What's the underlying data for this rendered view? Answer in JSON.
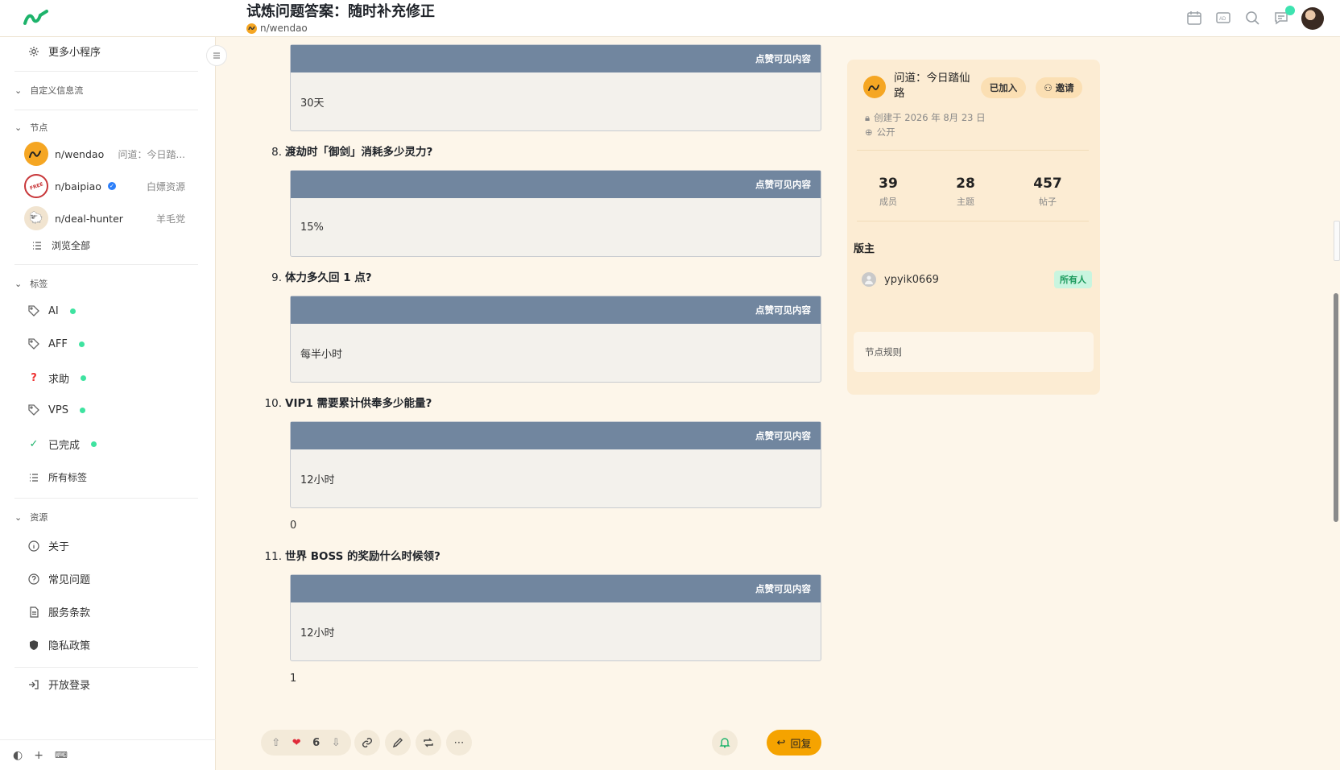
{
  "header": {
    "title": "试炼问题答案：随时补充修正",
    "node": "n/wendao"
  },
  "sidebar": {
    "more_apps": "更多小程序",
    "custom_feed": "自定义信息流",
    "nodes_section": "节点",
    "nodes": [
      {
        "name": "n/wendao",
        "sub": "问道：今日踏...",
        "color": "#f5a623"
      },
      {
        "name": "n/baipiao",
        "sub": "白嫖资源",
        "color": "#c8373a"
      },
      {
        "name": "n/deal-hunter",
        "sub": "羊毛党",
        "color": "#f1e4d0"
      }
    ],
    "browse_all": "浏览全部",
    "tags_section": "标签",
    "tags": [
      {
        "label": "AI",
        "icon": "tag-icon"
      },
      {
        "label": "AFF",
        "icon": "tag-icon"
      },
      {
        "label": "求助",
        "icon": "question-icon"
      },
      {
        "label": "VPS",
        "icon": "tag-icon"
      },
      {
        "label": "已完成",
        "icon": "check-icon"
      }
    ],
    "all_tags": "所有标签",
    "resources_section": "资源",
    "resources": [
      {
        "label": "关于",
        "icon": "info-icon"
      },
      {
        "label": "常见问题",
        "icon": "help-circle-icon"
      },
      {
        "label": "服务条款",
        "icon": "document-icon"
      },
      {
        "label": "隐私政策",
        "icon": "shield-icon"
      }
    ],
    "open_login": "开放登录"
  },
  "content": {
    "hidden_label": "点赞可见内容",
    "items": [
      {
        "num": "",
        "question": "",
        "answer": "30天",
        "after": ""
      },
      {
        "num": "8.",
        "question": "渡劫时「御剑」消耗多少灵力?",
        "answer": "15%",
        "after": ""
      },
      {
        "num": "9.",
        "question": "体力多久回 1 点?",
        "answer": "每半小时",
        "after": ""
      },
      {
        "num": "10.",
        "question": "VIP1 需要累计供奉多少能量?",
        "answer": "12小时",
        "after": "0"
      },
      {
        "num": "11.",
        "question": "世界 BOSS 的奖励什么时候领?",
        "answer": "12小时",
        "after": "1"
      }
    ]
  },
  "actions": {
    "like_count": "6",
    "reply": "回复"
  },
  "panel": {
    "node_name": "问道：今日踏仙路",
    "joined": "已加入",
    "invite": "邀请",
    "created": "创建于 2026 年 8月 23 日",
    "visibility": "公开",
    "stats": [
      {
        "num": "39",
        "label": "成员"
      },
      {
        "num": "28",
        "label": "主题"
      },
      {
        "num": "457",
        "label": "帖子"
      }
    ],
    "moderators_title": "版主",
    "moderator": "ypyik0669",
    "owner_badge": "所有人",
    "rules": "节点规则"
  },
  "colors": {
    "accent": "#f5a300",
    "hidden_header": "#71869f",
    "online": "#3ee3a0"
  }
}
